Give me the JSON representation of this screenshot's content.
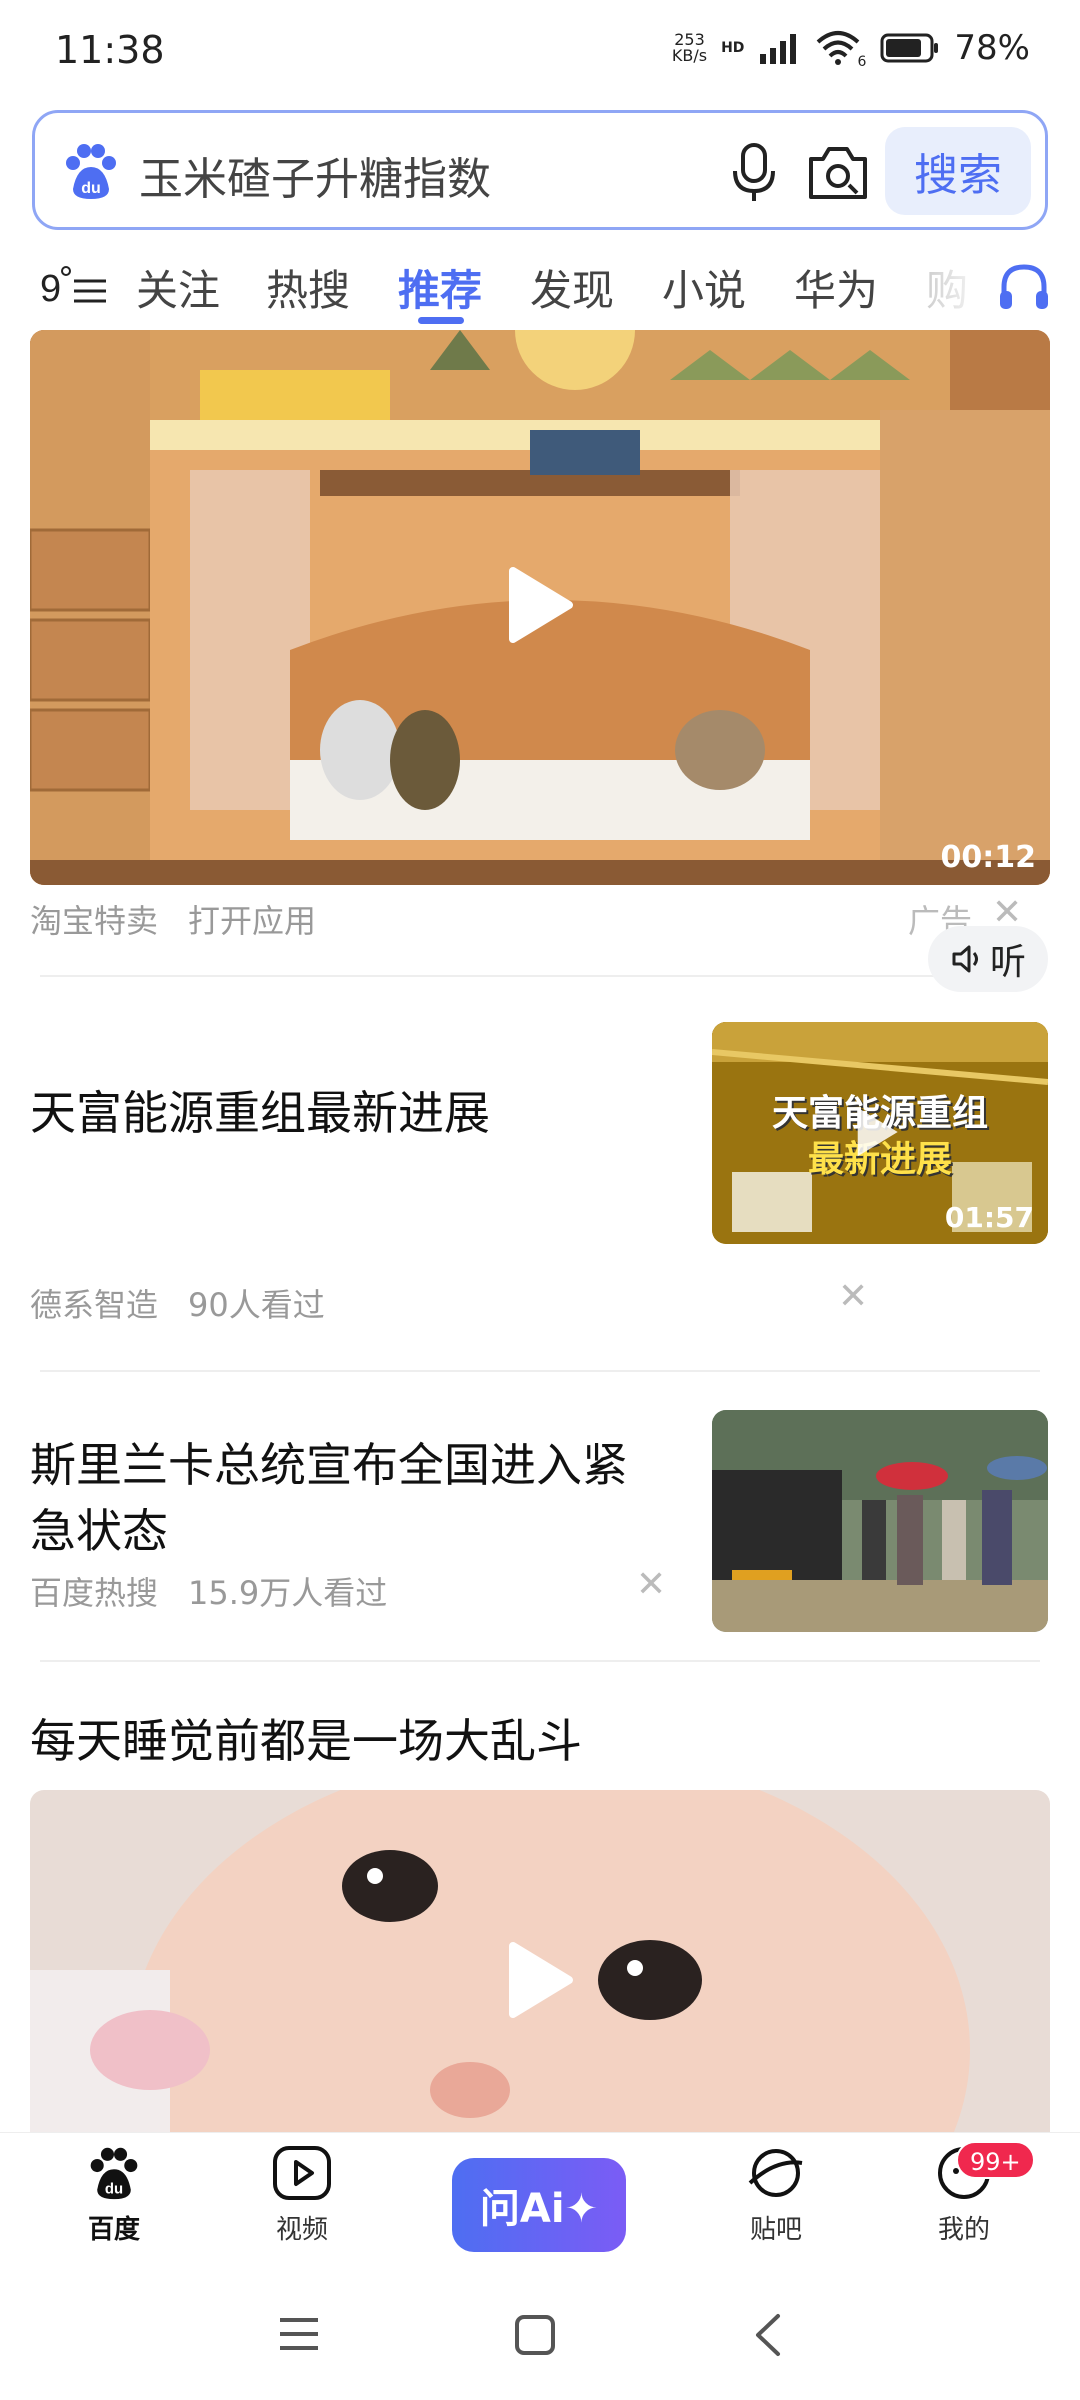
{
  "status_bar": {
    "time": "11:38",
    "net_speed_value": "253",
    "net_speed_unit": "KB/s",
    "hd_label": "HD",
    "wifi_level": "6",
    "battery_percent": "78%"
  },
  "search": {
    "query": "玉米碴子升糖指数",
    "button_label": "搜索"
  },
  "tabs": {
    "items": [
      "关注",
      "热搜",
      "推荐",
      "发现",
      "小说",
      "华为",
      "购"
    ],
    "active": "推荐"
  },
  "feed": {
    "ad": {
      "duration": "00:12",
      "source": "淘宝特卖",
      "action": "打开应用",
      "ad_label": "广告"
    },
    "item1": {
      "title": "天富能源重组最新进展",
      "thumb_overlay_line1": "天富能源重组",
      "thumb_overlay_line2": "最新进展",
      "duration": "01:57",
      "source": "德系智造",
      "views": "90人看过",
      "listen_label": "听"
    },
    "item2": {
      "title_line1": "斯里兰卡总统宣布全国进入紧",
      "title_line2": "急状态",
      "source": "百度热搜",
      "views": "15.9万人看过"
    },
    "item3": {
      "title": "每天睡觉前都是一场大乱斗"
    }
  },
  "bottom_nav": {
    "items": [
      {
        "label": "百度",
        "icon": "baidu-paw-icon",
        "active": true
      },
      {
        "label": "视频",
        "icon": "video-play-icon",
        "active": false
      },
      {
        "label": "贴吧",
        "icon": "tieba-planet-icon",
        "active": false
      },
      {
        "label": "我的",
        "icon": "profile-icon",
        "active": false
      }
    ],
    "ai_button_label": "问Ai✦",
    "badge": "99+"
  },
  "colors": {
    "brand_blue": "#4e6ef2",
    "badge_red": "#f0284e",
    "meta_gray": "#999999"
  }
}
